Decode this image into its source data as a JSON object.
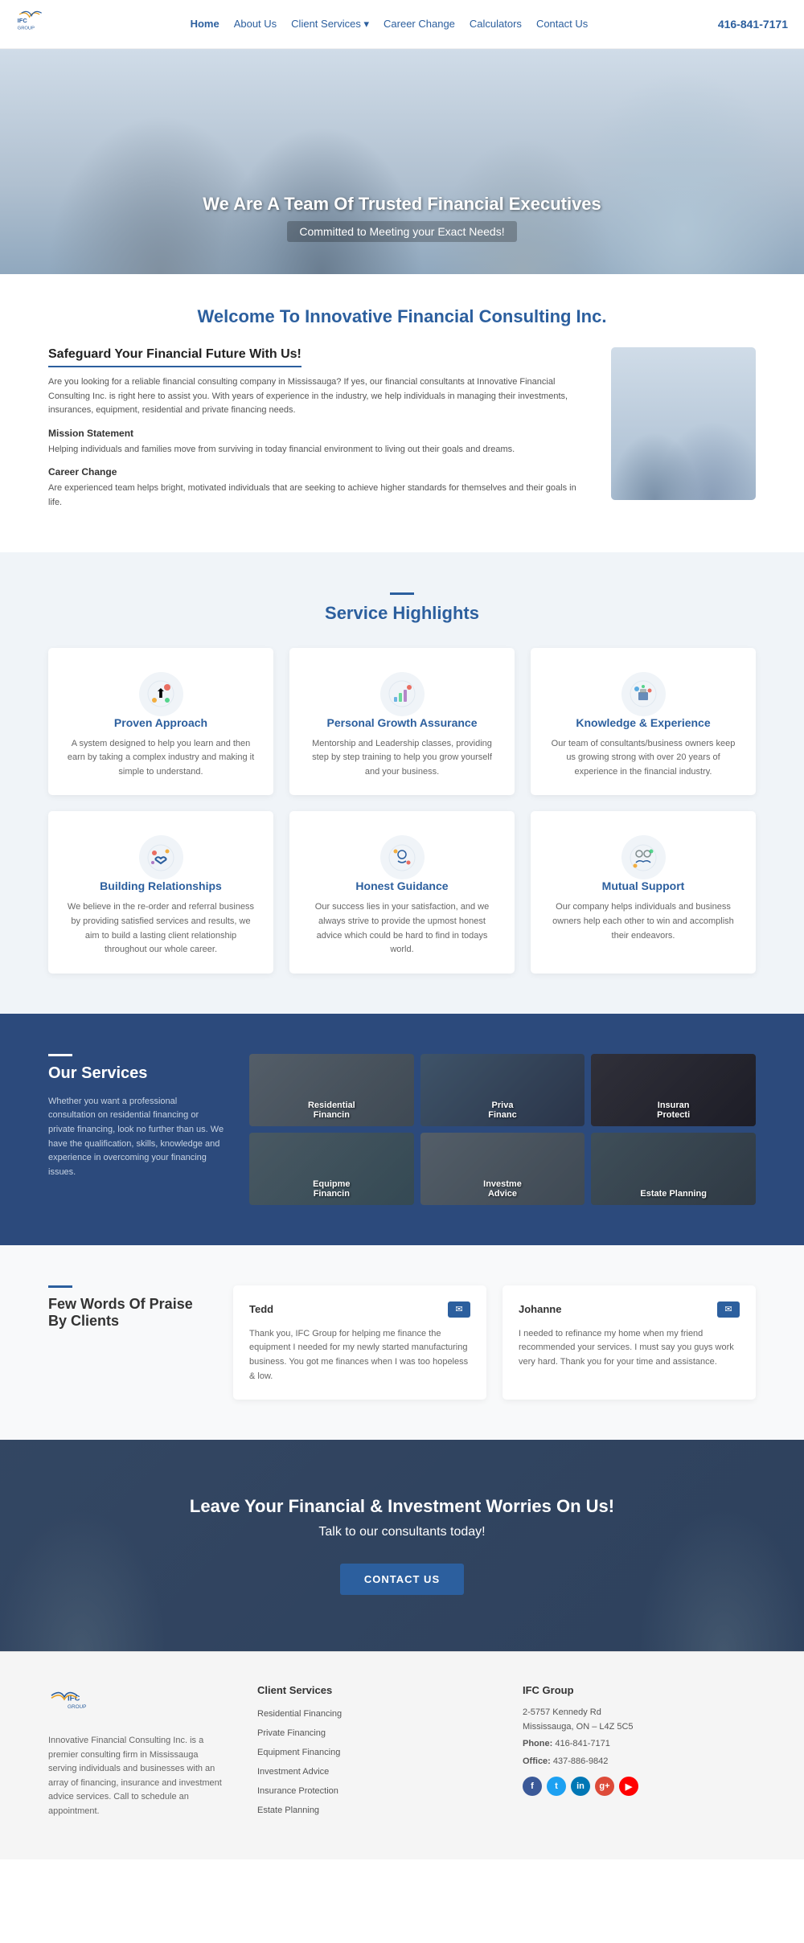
{
  "navbar": {
    "logo_alt": "IFC Group",
    "phone": "416-841-7171",
    "links": [
      {
        "label": "Home",
        "active": true
      },
      {
        "label": "About Us",
        "active": false
      },
      {
        "label": "Client Services",
        "active": false,
        "has_dropdown": true
      },
      {
        "label": "Career Change",
        "active": false
      },
      {
        "label": "Calculators",
        "active": false
      },
      {
        "label": "Contact Us",
        "active": false
      }
    ]
  },
  "hero": {
    "title": "We Are A Team Of Trusted Financial Executives",
    "subtitle": "Committed to Meeting your Exact Needs!"
  },
  "welcome": {
    "section_title": "Welcome To Innovative Financial Consulting Inc.",
    "heading": "Safeguard Your Financial Future With Us!",
    "paragraph1": "Are you looking for a reliable financial consulting company in Mississauga? If yes, our financial consultants at Innovative Financial Consulting Inc. is right here to assist you. With years of experience in the industry, we help individuals in managing their investments, insurances, equipment, residential and private financing needs.",
    "mission_title": "Mission Statement",
    "mission_text": "Helping individuals and families move from surviving in today financial environment to living out their goals and dreams.",
    "career_title": "Career Change",
    "career_text": "Are experienced team helps bright, motivated individuals that are seeking to achieve higher standards for themselves and their goals in life."
  },
  "service_highlights": {
    "section_title": "Service Highlights",
    "cards": [
      {
        "title": "Proven Approach",
        "description": "A system designed to help you learn and then earn by taking a complex industry and making it simple to understand.",
        "icon": "proven"
      },
      {
        "title": "Personal Growth Assurance",
        "description": "Mentorship and Leadership classes, providing step by step training to help you grow yourself and your business.",
        "icon": "growth"
      },
      {
        "title": "Knowledge & Experience",
        "description": "Our team of consultants/business owners keep us growing strong with over 20 years of experience in the financial industry.",
        "icon": "knowledge"
      },
      {
        "title": "Building Relationships",
        "description": "We believe in the re-order and referral business by providing satisfied services and results, we aim to build a lasting client relationship throughout our whole career.",
        "icon": "relationships"
      },
      {
        "title": "Honest Guidance",
        "description": "Our success lies in your satisfaction, and we always strive to provide the upmost honest advice which could be hard to find in todays world.",
        "icon": "guidance"
      },
      {
        "title": "Mutual Support",
        "description": "Our company helps individuals and business owners help each other to win and accomplish their endeavors.",
        "icon": "support"
      }
    ]
  },
  "our_services": {
    "section_title": "Our Services",
    "description": "Whether you want a professional consultation on residential financing or private financing, look no further than us. We have the qualification, skills, knowledge and experience in overcoming your financing issues.",
    "tiles": [
      {
        "label": "Residential\nFinancin"
      },
      {
        "label": "Priva\nFinanc"
      },
      {
        "label": "Insuran\nProtecti"
      },
      {
        "label": "Equipme\nFinancin"
      },
      {
        "label": "Investme\nAdvice"
      },
      {
        "label": "Estate Planning"
      }
    ]
  },
  "testimonials": {
    "section_title": "Few Words Of Praise By Clients",
    "cards": [
      {
        "name": "Tedd",
        "text": "Thank you, IFC Group for helping me finance the equipment I needed for my newly started manufacturing business. You got me finances when I was too hopeless & low."
      },
      {
        "name": "Johanne",
        "text": "I needed to refinance my home when my friend recommended your services. I must say you guys work very hard. Thank you for your time and assistance."
      }
    ]
  },
  "cta": {
    "title": "Leave Your Financial & Investment Worries On Us!",
    "subtitle": "Talk to our consultants today!",
    "button_label": "CONTACT US"
  },
  "footer": {
    "logo_alt": "IFC Group",
    "company_description": "Innovative Financial Consulting Inc. is a premier consulting firm in Mississauga serving individuals and businesses with an array of financing, insurance and investment advice services. Call to schedule an appointment.",
    "client_services_title": "Client Services",
    "client_services_links": [
      "Residential Financing",
      "Private Financing",
      "Equipment Financing",
      "Investment Advice",
      "Insurance Protection",
      "Estate Planning"
    ],
    "ifc_group_title": "IFC Group",
    "address": "2-5757 Kennedy Rd\nMississauga, ON – L4Z 5C5",
    "phone_label": "Phone:",
    "phone": "416-841-7171",
    "office_label": "Office:",
    "office": "437-886-9842",
    "socials": [
      "f",
      "t",
      "in",
      "g+",
      "▶"
    ]
  }
}
